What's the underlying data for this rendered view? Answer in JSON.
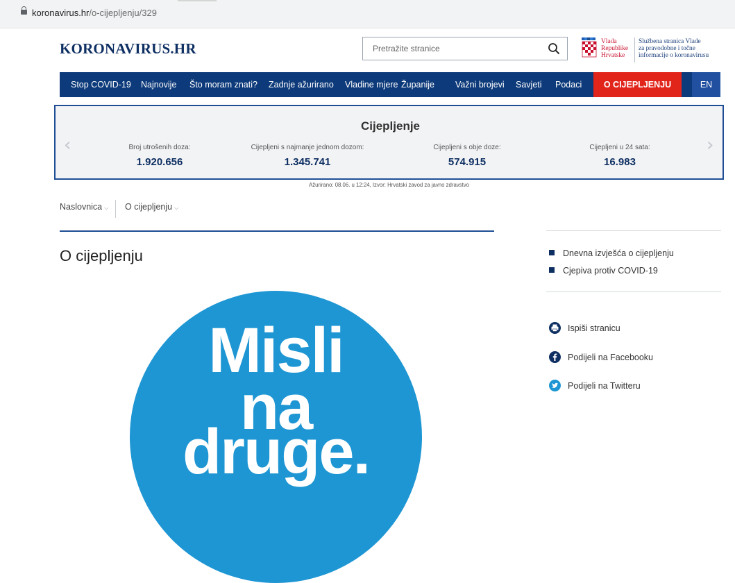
{
  "browser": {
    "url_domain": "koronavirus.hr",
    "url_path": "/o-cijepljenju/329"
  },
  "header": {
    "logo": "KORONAVIRUS.HR",
    "search_placeholder": "Pretražite stranice",
    "gov_line1": "Vlada",
    "gov_line2": "Republike",
    "gov_line3": "Hrvatske",
    "official_line1": "Službena stranica Vlade",
    "official_line2": "za pravodobne i točne",
    "official_line3": "informacije o koronavirusu"
  },
  "nav": {
    "items": [
      "Stop COVID-19",
      "Najnovije",
      "Što moram znati?",
      "Zadnje ažurirano",
      "Vladine mjere",
      "Županije",
      "Važni brojevi",
      "Savjeti",
      "Podaci"
    ],
    "cta": "O CIJEPLJENJU",
    "lang": "EN"
  },
  "stats": {
    "title": "Cijepljenje",
    "columns": [
      {
        "label": "Broj utrošenih doza:",
        "value": "1.920.656"
      },
      {
        "label": "Cijepljeni s najmanje jednom dozom:",
        "value": "1.345.741"
      },
      {
        "label": "Cijepljeni s obje doze:",
        "value": "574.915"
      },
      {
        "label": "Cijepljeni u 24 sata:",
        "value": "16.983"
      }
    ],
    "updated": "Ažurirano: 08.06. u 12:24, Izvor: Hrvatski zavod za javno zdravstvo"
  },
  "breadcrumb": {
    "home": "Naslovnica",
    "current": "O cijepljenju"
  },
  "page": {
    "title": "O cijepljenju",
    "hero_lines": [
      "Misli",
      "na",
      "druge."
    ]
  },
  "sidebar": {
    "links": [
      "Dnevna izvješća o cijepljenju",
      "Cjepiva protiv COVID-19"
    ],
    "share": {
      "print": "Ispiši stranicu",
      "facebook": "Podijeli na Facebooku",
      "twitter": "Podijeli na Twitteru"
    }
  },
  "colors": {
    "brand_navy": "#0d3a7a",
    "cta_red": "#e1251b",
    "hero_blue": "#1e96d3",
    "lang_blue": "#2150a0"
  }
}
